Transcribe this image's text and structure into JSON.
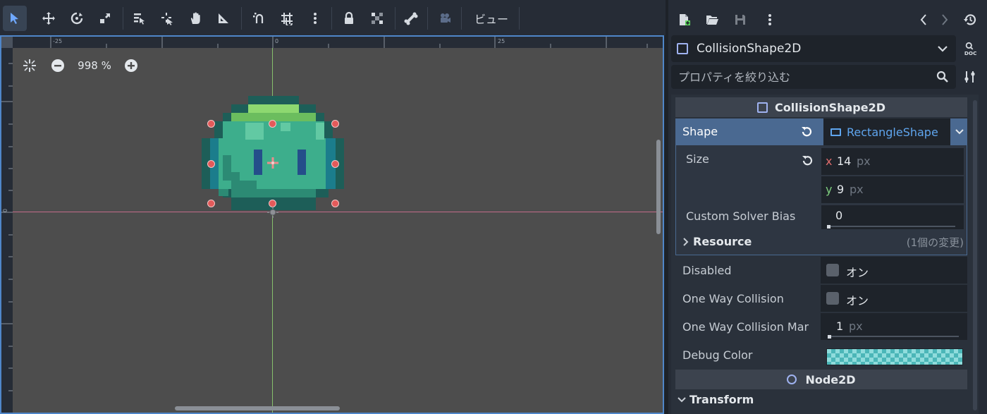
{
  "toolbar": {
    "view_menu_label": "ビュー",
    "icons": [
      "select-arrow-icon",
      "move-icon",
      "rotate-icon",
      "scale-icon",
      "list-select-icon",
      "pivot-icon",
      "pan-hand-icon",
      "ruler-icon",
      "smart-snap-icon",
      "grid-snap-icon",
      "more-vertical-icon",
      "lock-icon",
      "group-icon",
      "bone-icon",
      "camera-icon"
    ]
  },
  "viewport": {
    "zoom_value": "998 %",
    "ruler_top_labels": [
      "-25",
      "0",
      "25"
    ],
    "ruler_left_labels": [
      "0"
    ]
  },
  "inspector": {
    "node_name": "CollisionShape2D",
    "filter_placeholder": "プロパティを絞り込む",
    "sections": {
      "collision": "CollisionShape2D",
      "node2d": "Node2D"
    },
    "shape": {
      "label": "Shape",
      "value": "RectangleShape"
    },
    "size": {
      "label": "Size",
      "x_letter": "x",
      "x_value": "14",
      "y_letter": "y",
      "y_value": "9",
      "unit": "px"
    },
    "custom_solver_bias": {
      "label": "Custom Solver Bias",
      "value": "0"
    },
    "resource": {
      "label": "Resource",
      "changes": "(1個の変更)"
    },
    "disabled": {
      "label": "Disabled",
      "value_label": "オン"
    },
    "one_way_collision": {
      "label": "One Way Collision",
      "value_label": "オン"
    },
    "one_way_margin": {
      "label": "One Way Collision Mar",
      "value": "1",
      "unit": "px"
    },
    "debug_color": {
      "label": "Debug Color"
    },
    "transform": {
      "label": "Transform"
    }
  },
  "colors": {
    "accent": "#4f86c9",
    "selected_row": "#4a6991",
    "resource_link": "#5fa5ee",
    "x_axis_letter": "#e06c6c",
    "y_axis_letter": "#7fcf7f"
  }
}
